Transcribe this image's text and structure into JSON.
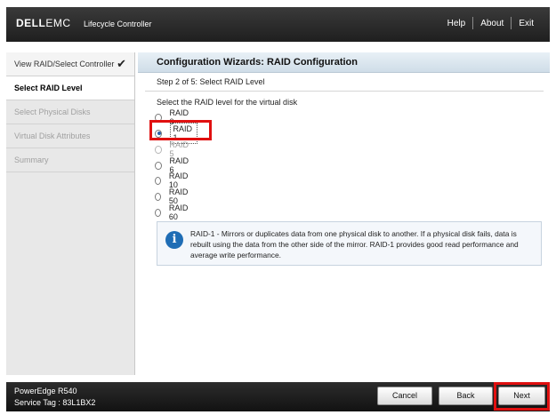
{
  "header": {
    "logo_dell": "DELL",
    "logo_emc": "EMC",
    "product": "Lifecycle Controller",
    "nav": [
      "Help",
      "About",
      "Exit"
    ]
  },
  "sidebar": {
    "steps": [
      {
        "label": "View RAID/Select Controller",
        "state": "done"
      },
      {
        "label": "Select RAID Level",
        "state": "active"
      },
      {
        "label": "Select Physical Disks",
        "state": "pending"
      },
      {
        "label": "Virtual Disk Attributes",
        "state": "pending"
      },
      {
        "label": "Summary",
        "state": "pending"
      }
    ]
  },
  "main": {
    "title": "Configuration Wizards: RAID Configuration",
    "step_text": "Step 2 of 5: Select RAID Level",
    "prompt": "Select the RAID level for the virtual disk",
    "raid_options": [
      {
        "label": "RAID 0",
        "enabled": true,
        "selected": false
      },
      {
        "label": "RAID 1",
        "enabled": true,
        "selected": true
      },
      {
        "label": "RAID 5",
        "enabled": false,
        "selected": false
      },
      {
        "label": "RAID 6",
        "enabled": true,
        "selected": false
      },
      {
        "label": "RAID 10",
        "enabled": true,
        "selected": false
      },
      {
        "label": "RAID 50",
        "enabled": true,
        "selected": false
      },
      {
        "label": "RAID 60",
        "enabled": true,
        "selected": false
      }
    ],
    "info_text": "RAID-1 - Mirrors or duplicates data from one physical disk to another. If a physical disk fails, data is rebuilt using the data from the other side of the mirror. RAID-1 provides good read performance and average write performance.",
    "info_icon": "info-icon"
  },
  "footer": {
    "model": "PowerEdge R540",
    "service_tag": "Service Tag : 83L1BX2",
    "cancel_label": "Cancel",
    "back_label": "Back",
    "next_label": "Next"
  },
  "colors": {
    "highlight": "#e01010",
    "accent": "#1f6db5"
  }
}
